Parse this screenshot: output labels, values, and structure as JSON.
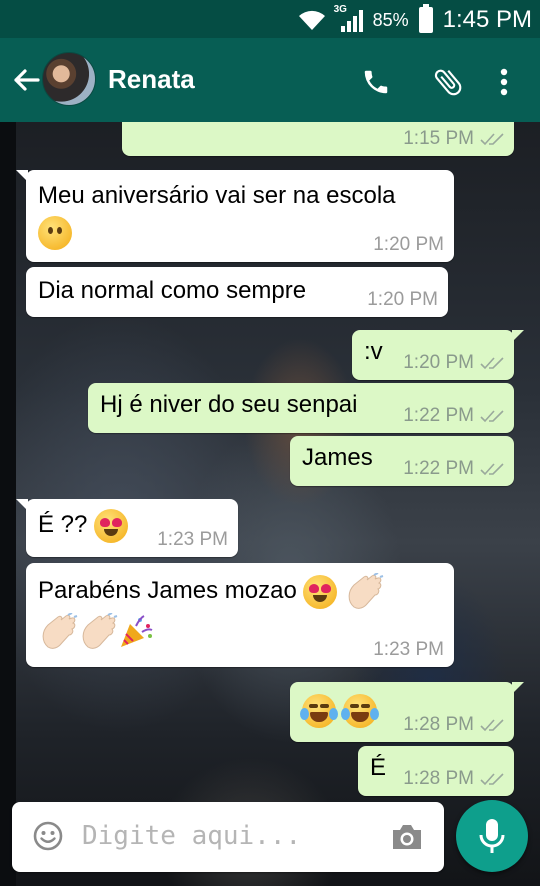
{
  "status_bar": {
    "network": "3G",
    "battery_percent": "85%",
    "time": "1:45 PM"
  },
  "header": {
    "contact_name": "Renata"
  },
  "messages": [
    {
      "direction": "out",
      "text": "",
      "time": "1:15 PM"
    },
    {
      "direction": "in",
      "text": "Meu aniversário vai ser na escola",
      "time": "1:20 PM",
      "emoji": [
        "neutral-face"
      ]
    },
    {
      "direction": "in",
      "text": "Dia normal como sempre",
      "time": "1:20 PM"
    },
    {
      "direction": "out",
      "text": ":v",
      "time": "1:20 PM"
    },
    {
      "direction": "out",
      "text": "Hj é niver do seu senpai",
      "time": "1:22 PM"
    },
    {
      "direction": "out",
      "text": "James",
      "time": "1:22 PM"
    },
    {
      "direction": "in",
      "text": "É ??",
      "time": "1:23 PM",
      "emoji": [
        "heart-eyes-face"
      ]
    },
    {
      "direction": "in",
      "text": "Parabéns James mozao",
      "time": "1:23 PM",
      "emoji": [
        "heart-eyes-face",
        "clapping-hands",
        "clapping-hands",
        "clapping-hands",
        "party-popper"
      ]
    },
    {
      "direction": "out",
      "text": "",
      "time": "1:28 PM",
      "emoji": [
        "tears-of-joy-face",
        "tears-of-joy-face"
      ]
    },
    {
      "direction": "out",
      "text": "É",
      "time": "1:28 PM"
    }
  ],
  "composer": {
    "placeholder": "Digite aqui..."
  },
  "colors": {
    "app_bar": "#075e54",
    "status_bar": "#054d44",
    "outgoing_bubble": "#dcf8c6",
    "incoming_bubble": "#ffffff",
    "fab": "#0e9f8c"
  }
}
